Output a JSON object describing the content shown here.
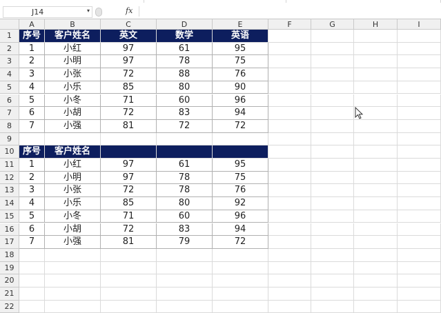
{
  "name_box": "J14",
  "fx_label": "fx",
  "columns": [
    "A",
    "B",
    "C",
    "D",
    "E",
    "F",
    "G",
    "H",
    "I"
  ],
  "rows": [
    "1",
    "2",
    "3",
    "4",
    "5",
    "6",
    "7",
    "8",
    "9",
    "10",
    "11",
    "12",
    "13",
    "14",
    "15",
    "16",
    "17",
    "18",
    "19",
    "20",
    "21",
    "22"
  ],
  "table1": {
    "headers": [
      "序号",
      "客户姓名",
      "英文",
      "数学",
      "英语"
    ],
    "rows": [
      [
        "1",
        "小红",
        "97",
        "61",
        "95"
      ],
      [
        "2",
        "小明",
        "97",
        "78",
        "75"
      ],
      [
        "3",
        "小张",
        "72",
        "88",
        "76"
      ],
      [
        "4",
        "小乐",
        "85",
        "80",
        "90"
      ],
      [
        "5",
        "小冬",
        "71",
        "60",
        "96"
      ],
      [
        "6",
        "小胡",
        "72",
        "83",
        "94"
      ],
      [
        "7",
        "小强",
        "81",
        "72",
        "72"
      ]
    ]
  },
  "table2": {
    "headers": [
      "序号",
      "客户姓名",
      "",
      "",
      ""
    ],
    "rows": [
      [
        "1",
        "小红",
        "97",
        "61",
        "95"
      ],
      [
        "2",
        "小明",
        "97",
        "78",
        "75"
      ],
      [
        "3",
        "小张",
        "72",
        "78",
        "76"
      ],
      [
        "4",
        "小乐",
        "85",
        "80",
        "92"
      ],
      [
        "5",
        "小冬",
        "71",
        "60",
        "96"
      ],
      [
        "6",
        "小胡",
        "72",
        "83",
        "94"
      ],
      [
        "7",
        "小强",
        "81",
        "79",
        "72"
      ]
    ]
  },
  "colors": {
    "header_fill": "#0d1e5e",
    "header_text": "#ffffff",
    "grid": "#dadada"
  }
}
